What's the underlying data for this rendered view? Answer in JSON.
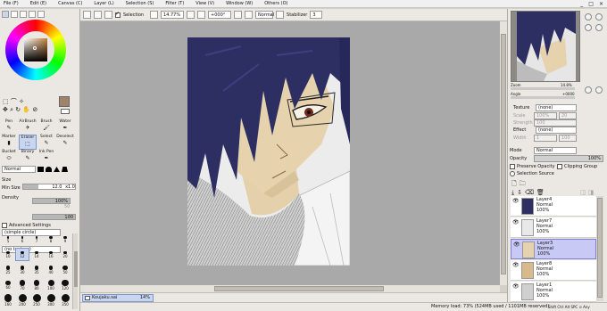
{
  "menubar": {
    "items": [
      "File (F)",
      "Edit (E)",
      "Canvas (C)",
      "Layer (L)",
      "Selection (S)",
      "Filter (T)",
      "View (V)",
      "Window (W)",
      "Others (O)"
    ],
    "minimize": "_",
    "restore": "□",
    "close": "×"
  },
  "toolbar": {
    "selection_label": "Selection",
    "zoom": "14.77%",
    "angle": "+000°",
    "blend": "Normal",
    "stabilizer_label": "Stabilizer",
    "stabilizer_value": "3"
  },
  "color": {
    "primary": "#a0846a",
    "secondary": "#ffffff"
  },
  "tools": [
    {
      "label": "Pen",
      "icon": "pen-icon",
      "glyph": "✎"
    },
    {
      "label": "AirBrush",
      "icon": "airbrush-icon",
      "glyph": "✈"
    },
    {
      "label": "Brush",
      "icon": "brush-icon",
      "glyph": "🖌"
    },
    {
      "label": "Water",
      "icon": "water-icon",
      "glyph": "✒"
    },
    {
      "label": "Marker",
      "icon": "marker-icon",
      "glyph": "▮"
    },
    {
      "label": "Eraser",
      "icon": "eraser-icon",
      "glyph": "⬚"
    },
    {
      "label": "Select",
      "icon": "select-icon",
      "glyph": "✎"
    },
    {
      "label": "Deselect",
      "icon": "deselect-icon",
      "glyph": "✎"
    },
    {
      "label": "Bucket",
      "icon": "bucket-icon",
      "glyph": "⬭"
    },
    {
      "label": "Binary",
      "icon": "binary-icon",
      "glyph": "✎"
    },
    {
      "label": "Ink Pen",
      "icon": "ink-pen-icon",
      "glyph": "✒"
    }
  ],
  "brush": {
    "blend": "Normal",
    "size_label": "Size",
    "size_mult": "x1.0",
    "size_value": "12.0",
    "size_level": 0.3,
    "min_size_label": "Min Size",
    "min_size_value": "100%",
    "min_size_level": 1.0,
    "density_label": "Density",
    "density_value": "100",
    "density_level": 1.0,
    "shape": "(simple circle)",
    "shape_value": "50",
    "texture": "(no texture)",
    "texture_value": "95",
    "advanced": "Advanced Settings"
  },
  "brush_sizes": [
    "5",
    "6",
    "7",
    "8",
    "9",
    "10",
    "12",
    "14",
    "16",
    "20",
    "25",
    "30",
    "35",
    "40",
    "50",
    "60",
    "70",
    "80",
    "100",
    "120",
    "160",
    "200",
    "250",
    "300",
    "350"
  ],
  "navigator": {
    "zoom_label": "Zoom",
    "zoom_value": "14.8%",
    "angle_label": "Angle",
    "angle_value": "+0000"
  },
  "layer_props": {
    "texture_label": "Texture",
    "texture_value": "(none)",
    "scale_label": "Scale",
    "scale_value": "100%",
    "scale_num": "20",
    "strength_label": "Strength",
    "strength_value": "100",
    "effect_label": "Effect",
    "effect_value": "(none)",
    "width_label": "Width",
    "width_value": "1",
    "width_num": "100",
    "mode_label": "Mode",
    "mode_value": "Normal",
    "opacity_label": "Opacity",
    "opacity_value": "100%",
    "preserve_opacity": "Preserve Opacity",
    "clipping_group": "Clipping Group",
    "selection_source": "Selection Source"
  },
  "layers": [
    {
      "name": "Layer4",
      "mode": "Normal",
      "opacity": "100%"
    },
    {
      "name": "Layer7",
      "mode": "Normal",
      "opacity": "100%"
    },
    {
      "name": "Layer3",
      "mode": "Normal",
      "opacity": "100%"
    },
    {
      "name": "Layer8",
      "mode": "Normal",
      "opacity": "100%"
    },
    {
      "name": "Layer1",
      "mode": "Normal",
      "opacity": "100%"
    }
  ],
  "document": {
    "name": "Koujaku.sai",
    "zoom": "14%"
  },
  "status": {
    "memory": "Memory load: 73% (524MB used / 1101MB reserved)",
    "keys": "Shift Ctrl Alt SPC ⊙ Any"
  }
}
